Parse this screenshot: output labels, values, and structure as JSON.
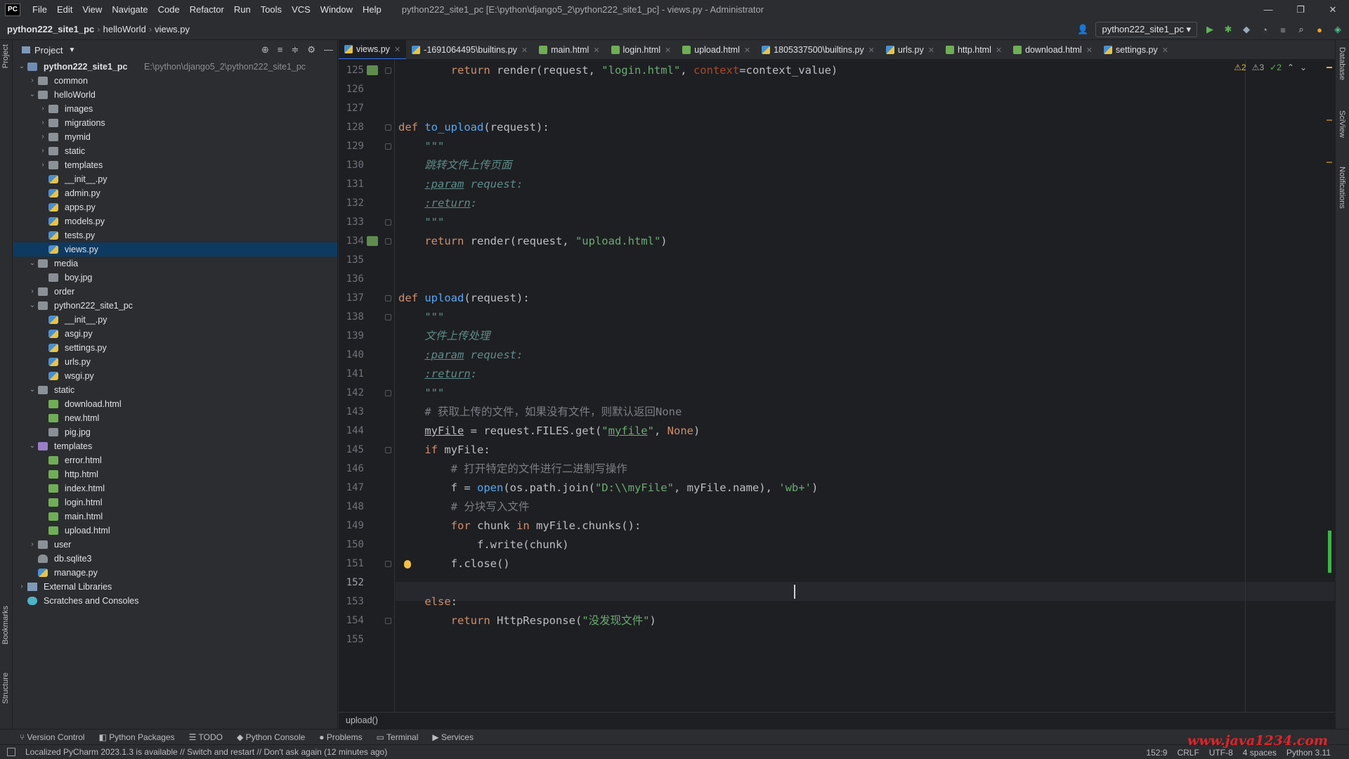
{
  "menu": [
    "File",
    "Edit",
    "View",
    "Navigate",
    "Code",
    "Refactor",
    "Run",
    "Tools",
    "VCS",
    "Window",
    "Help"
  ],
  "window_title": "python222_site1_pc [E:\\python\\django5_2\\python222_site1_pc] - views.py - Administrator",
  "logo_text": "PC",
  "breadcrumb": [
    "python222_site1_pc",
    "helloWorld",
    "views.py"
  ],
  "run_config": "python222_site1_pc",
  "project_panel": {
    "title": "Project",
    "root_name": "python222_site1_pc",
    "root_path": "E:\\python\\django5_2\\python222_site1_pc"
  },
  "tree": [
    {
      "depth": 1,
      "arrow": "›",
      "icon": "folder",
      "label": "common"
    },
    {
      "depth": 1,
      "arrow": "⌄",
      "icon": "folder",
      "label": "helloWorld"
    },
    {
      "depth": 2,
      "arrow": "›",
      "icon": "folder",
      "label": "images"
    },
    {
      "depth": 2,
      "arrow": "›",
      "icon": "folder",
      "label": "migrations"
    },
    {
      "depth": 2,
      "arrow": "›",
      "icon": "folder",
      "label": "mymid"
    },
    {
      "depth": 2,
      "arrow": "›",
      "icon": "folder",
      "label": "static"
    },
    {
      "depth": 2,
      "arrow": "›",
      "icon": "folder",
      "label": "templates"
    },
    {
      "depth": 2,
      "arrow": "",
      "icon": "py",
      "label": "__init__.py"
    },
    {
      "depth": 2,
      "arrow": "",
      "icon": "py",
      "label": "admin.py"
    },
    {
      "depth": 2,
      "arrow": "",
      "icon": "py",
      "label": "apps.py"
    },
    {
      "depth": 2,
      "arrow": "",
      "icon": "py",
      "label": "models.py"
    },
    {
      "depth": 2,
      "arrow": "",
      "icon": "py",
      "label": "tests.py"
    },
    {
      "depth": 2,
      "arrow": "",
      "icon": "py",
      "label": "views.py",
      "selected": true
    },
    {
      "depth": 1,
      "arrow": "⌄",
      "icon": "folder",
      "label": "media"
    },
    {
      "depth": 2,
      "arrow": "",
      "icon": "img",
      "label": "boy.jpg"
    },
    {
      "depth": 1,
      "arrow": "›",
      "icon": "folder",
      "label": "order"
    },
    {
      "depth": 1,
      "arrow": "⌄",
      "icon": "folder",
      "label": "python222_site1_pc"
    },
    {
      "depth": 2,
      "arrow": "",
      "icon": "py",
      "label": "__init__.py"
    },
    {
      "depth": 2,
      "arrow": "",
      "icon": "py",
      "label": "asgi.py"
    },
    {
      "depth": 2,
      "arrow": "",
      "icon": "py",
      "label": "settings.py"
    },
    {
      "depth": 2,
      "arrow": "",
      "icon": "py",
      "label": "urls.py"
    },
    {
      "depth": 2,
      "arrow": "",
      "icon": "py",
      "label": "wsgi.py"
    },
    {
      "depth": 1,
      "arrow": "⌄",
      "icon": "folder",
      "label": "static"
    },
    {
      "depth": 2,
      "arrow": "",
      "icon": "html",
      "label": "download.html"
    },
    {
      "depth": 2,
      "arrow": "",
      "icon": "html",
      "label": "new.html"
    },
    {
      "depth": 2,
      "arrow": "",
      "icon": "img",
      "label": "pig.jpg"
    },
    {
      "depth": 1,
      "arrow": "⌄",
      "icon": "folder-purple",
      "label": "templates"
    },
    {
      "depth": 2,
      "arrow": "",
      "icon": "html",
      "label": "error.html"
    },
    {
      "depth": 2,
      "arrow": "",
      "icon": "html",
      "label": "http.html"
    },
    {
      "depth": 2,
      "arrow": "",
      "icon": "html",
      "label": "index.html"
    },
    {
      "depth": 2,
      "arrow": "",
      "icon": "html",
      "label": "login.html"
    },
    {
      "depth": 2,
      "arrow": "",
      "icon": "html",
      "label": "main.html"
    },
    {
      "depth": 2,
      "arrow": "",
      "icon": "html",
      "label": "upload.html"
    },
    {
      "depth": 1,
      "arrow": "›",
      "icon": "folder",
      "label": "user"
    },
    {
      "depth": 1,
      "arrow": "",
      "icon": "db",
      "label": "db.sqlite3"
    },
    {
      "depth": 1,
      "arrow": "",
      "icon": "py",
      "label": "manage.py"
    },
    {
      "depth": 0,
      "arrow": "›",
      "icon": "lib",
      "label": "External Libraries"
    },
    {
      "depth": 0,
      "arrow": "",
      "icon": "scr",
      "label": "Scratches and Consoles"
    }
  ],
  "tabs": [
    {
      "label": "views.py",
      "icon": "py",
      "active": true
    },
    {
      "label": "-1691064495\\builtins.py",
      "icon": "py"
    },
    {
      "label": "main.html",
      "icon": "html"
    },
    {
      "label": "login.html",
      "icon": "html"
    },
    {
      "label": "upload.html",
      "icon": "html"
    },
    {
      "label": "1805337500\\builtins.py",
      "icon": "py"
    },
    {
      "label": "urls.py",
      "icon": "py"
    },
    {
      "label": "http.html",
      "icon": "html"
    },
    {
      "label": "download.html",
      "icon": "html"
    },
    {
      "label": "settings.py",
      "icon": "py"
    }
  ],
  "inspections": {
    "warnings": "2",
    "weak_warnings": "3",
    "ok": "2"
  },
  "code_lines": [
    {
      "n": "125",
      "t": [
        [
          "kw",
          "        return "
        ],
        [
          "pl",
          "render(request, "
        ],
        [
          "str",
          "\"login.html\""
        ],
        [
          "pl",
          ", "
        ],
        [
          "param",
          "context"
        ],
        [
          "pl",
          "=context_value)"
        ]
      ]
    },
    {
      "n": "126",
      "t": []
    },
    {
      "n": "127",
      "t": []
    },
    {
      "n": "128",
      "t": [
        [
          "kw",
          "def "
        ],
        [
          "fn",
          "to_upload"
        ],
        [
          "pl",
          "(request):"
        ]
      ]
    },
    {
      "n": "129",
      "t": [
        [
          "doc",
          "    \"\"\""
        ]
      ]
    },
    {
      "n": "130",
      "t": [
        [
          "doc",
          "    跳转文件上传页面"
        ]
      ]
    },
    {
      "n": "131",
      "t": [
        [
          "doc",
          "    "
        ],
        [
          "doctag",
          ":param"
        ],
        [
          "doc",
          " request:"
        ]
      ]
    },
    {
      "n": "132",
      "t": [
        [
          "doc",
          "    "
        ],
        [
          "doctag",
          ":return"
        ],
        [
          "doc",
          ":"
        ]
      ]
    },
    {
      "n": "133",
      "t": [
        [
          "doc",
          "    \"\"\""
        ]
      ]
    },
    {
      "n": "134",
      "t": [
        [
          "kw",
          "    return "
        ],
        [
          "pl",
          "render(request, "
        ],
        [
          "str",
          "\"upload.html\""
        ],
        [
          "pl",
          ")"
        ]
      ]
    },
    {
      "n": "135",
      "t": []
    },
    {
      "n": "136",
      "t": []
    },
    {
      "n": "137",
      "t": [
        [
          "kw",
          "def "
        ],
        [
          "fn",
          "upload"
        ],
        [
          "pl",
          "(request):"
        ]
      ]
    },
    {
      "n": "138",
      "t": [
        [
          "doc",
          "    \"\"\""
        ]
      ]
    },
    {
      "n": "139",
      "t": [
        [
          "doc",
          "    文件上传处理"
        ]
      ]
    },
    {
      "n": "140",
      "t": [
        [
          "doc",
          "    "
        ],
        [
          "doctag",
          ":param"
        ],
        [
          "doc",
          " request:"
        ]
      ]
    },
    {
      "n": "141",
      "t": [
        [
          "doc",
          "    "
        ],
        [
          "doctag",
          ":return"
        ],
        [
          "doc",
          ":"
        ]
      ]
    },
    {
      "n": "142",
      "t": [
        [
          "doc",
          "    \"\"\""
        ]
      ]
    },
    {
      "n": "143",
      "t": [
        [
          "cmt2",
          "    # 获取上传的文件，如果没有文件，则默认返回None"
        ]
      ]
    },
    {
      "n": "144",
      "t": [
        [
          "pl",
          "    "
        ],
        [
          "und",
          "myFile"
        ],
        [
          "pl",
          " = request.FILES.get("
        ],
        [
          "str",
          "\""
        ],
        [
          "str und",
          "myfile"
        ],
        [
          "str",
          "\""
        ],
        [
          "pl",
          ", "
        ],
        [
          "kw",
          "None"
        ],
        [
          "pl",
          ")"
        ]
      ]
    },
    {
      "n": "145",
      "t": [
        [
          "kw",
          "    if "
        ],
        [
          "pl",
          "myFile:"
        ]
      ]
    },
    {
      "n": "146",
      "t": [
        [
          "cmt2",
          "        # 打开特定的文件进行二进制写操作"
        ]
      ]
    },
    {
      "n": "147",
      "t": [
        [
          "pl",
          "        f = "
        ],
        [
          "fn",
          "open"
        ],
        [
          "pl",
          "(os.path.join("
        ],
        [
          "str",
          "\"D:\\\\myFile\""
        ],
        [
          "pl",
          ", myFile.name), "
        ],
        [
          "str",
          "'wb+'"
        ],
        [
          "pl",
          ")"
        ]
      ]
    },
    {
      "n": "148",
      "t": [
        [
          "cmt2",
          "        # 分块写入文件"
        ]
      ]
    },
    {
      "n": "149",
      "t": [
        [
          "kw",
          "        for "
        ],
        [
          "pl",
          "chunk "
        ],
        [
          "kw",
          "in "
        ],
        [
          "pl",
          "myFile.chunks():"
        ]
      ]
    },
    {
      "n": "150",
      "t": [
        [
          "pl",
          "            f.write(chunk)"
        ]
      ]
    },
    {
      "n": "151",
      "t": [
        [
          "pl",
          "        f.close()"
        ]
      ]
    },
    {
      "n": "152",
      "t": [],
      "current": true
    },
    {
      "n": "153",
      "t": [
        [
          "kw",
          "    else"
        ],
        [
          "pl",
          ":"
        ]
      ]
    },
    {
      "n": "154",
      "t": [
        [
          "kw",
          "        return "
        ],
        [
          "pl",
          "HttpResponse("
        ],
        [
          "str",
          "\"没发现文件\""
        ],
        [
          "pl",
          ")"
        ]
      ]
    },
    {
      "n": "155",
      "t": []
    }
  ],
  "editor_breadcrumb": "upload()",
  "bottom_tools": [
    "Version Control",
    "Python Packages",
    "TODO",
    "Python Console",
    "Problems",
    "Terminal",
    "Services"
  ],
  "left_stripe": {
    "project": "Project",
    "bookmarks": "Bookmarks",
    "structure": "Structure"
  },
  "right_stripe": {
    "database": "Database",
    "sciview": "SciView",
    "notifications": "Notifications"
  },
  "status": {
    "message": "Localized PyCharm 2023.1.3 is available // Switch and restart // Don't ask again (12 minutes ago)",
    "position": "152:9",
    "line_sep": "CRLF",
    "encoding": "UTF-8",
    "indent": "4 spaces",
    "interpreter": "Python 3.11"
  },
  "watermark": "www.java1234.com",
  "colors": {
    "accent": "#3574f0",
    "selection": "#0e3a61",
    "editor_bg": "#1e1f22",
    "panel_bg": "#2b2d30"
  }
}
